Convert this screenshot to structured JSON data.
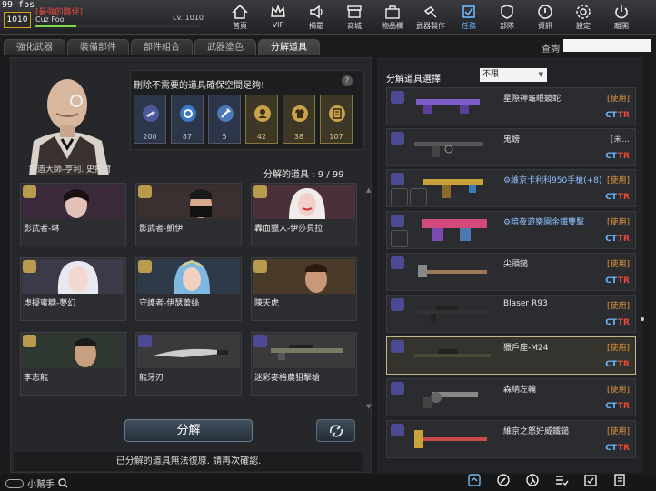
{
  "fps": "99 fps",
  "player": {
    "level_badge": "1010",
    "clan": "[最強的夥伴]",
    "name": "Cuz Foo",
    "level": "Lv. 1010"
  },
  "nav": [
    {
      "label": "首頁",
      "icon": "home-icon"
    },
    {
      "label": "VIP",
      "icon": "crown-icon"
    },
    {
      "label": "揭罷",
      "icon": "megaphone-icon"
    },
    {
      "label": "商城",
      "icon": "shop-icon"
    },
    {
      "label": "物品欄",
      "icon": "bag-icon"
    },
    {
      "label": "武器製作",
      "icon": "hammer-icon"
    },
    {
      "label": "任務",
      "icon": "mission-icon",
      "active": true
    },
    {
      "label": "部隊",
      "icon": "shield-icon"
    },
    {
      "label": "資訊",
      "icon": "info-icon"
    },
    {
      "label": "設定",
      "icon": "gear-icon"
    },
    {
      "label": "離開",
      "icon": "power-icon"
    }
  ],
  "tabs": [
    "強化武器",
    "裝備部件",
    "部件組合",
    "武器塗色",
    "分解道具"
  ],
  "active_tab": 4,
  "search": {
    "label": "查詢",
    "value": ""
  },
  "left": {
    "npc_name": "鍛造大師-亨利. 史托爾",
    "notice": "刪除不需要的道具確保空間足夠!",
    "help": "?",
    "stats": [
      {
        "icon": "rifle-icon",
        "value": "200"
      },
      {
        "icon": "gear-part-icon",
        "value": "87"
      },
      {
        "icon": "wrench-icon",
        "value": "5"
      },
      {
        "icon": "character-icon",
        "value": "42"
      },
      {
        "icon": "shirt-icon",
        "value": "38"
      },
      {
        "icon": "scroll-icon",
        "value": "107"
      }
    ],
    "count_label": "分解的道具 : 9 / 99",
    "cards": [
      {
        "name": "影武者-琳",
        "type": "char",
        "tone": "#3a2a3a"
      },
      {
        "name": "影武者-凱伊",
        "type": "char",
        "tone": "#3a3030"
      },
      {
        "name": "轟血獵人-伊莎貝拉",
        "type": "char",
        "tone": "#4a3038"
      },
      {
        "name": "虛擬蜜糖-夢幻",
        "type": "char",
        "tone": "#3a3a48"
      },
      {
        "name": "守護者-伊瑟蕾絲",
        "type": "char",
        "tone": "#2e3a48"
      },
      {
        "name": "陳天虎",
        "type": "char",
        "tone": "#4a3a2a"
      },
      {
        "name": "李志龍",
        "type": "char",
        "tone": "#2e3830"
      },
      {
        "name": "龍牙刃",
        "type": "wpn",
        "tone": "#3a3a3c"
      },
      {
        "name": "迷彩麥格農狙擊槍",
        "type": "wpn",
        "tone": "#3a3a3c"
      }
    ],
    "decompose_button": "分解",
    "warning": "已分解的道具無法復原. 請再次確認."
  },
  "right": {
    "title": "分解道具選擇",
    "filter": "不限",
    "items": [
      {
        "name": "星際神龜眼鏡蛇",
        "use": "[使用]",
        "color": "#7b5cc9",
        "selected": false
      },
      {
        "name": "鬼螃",
        "use": "[未...",
        "color": "#666",
        "selected": false
      },
      {
        "name": "維京卡利科950手槍(+8)",
        "use": "[使用]",
        "color": "#c9a13c",
        "selected": false,
        "slots": true,
        "prefix": "⚙"
      },
      {
        "name": "暗夜遊樂園金鐵雙擊",
        "use": "[使用]",
        "color": "#d24a7a",
        "selected": false,
        "slots": true,
        "prefix": "⚙"
      },
      {
        "name": "尖頭鎚",
        "use": "[使用]",
        "color": "#9a7a5a",
        "selected": false
      },
      {
        "name": "Blaser R93",
        "use": "[使用]",
        "color": "#333",
        "selected": false
      },
      {
        "name": "獵戶座-M24",
        "use": "[使用]",
        "color": "#4a4a3a",
        "selected": true
      },
      {
        "name": "森納左輪",
        "use": "[使用]",
        "color": "#888",
        "selected": false
      },
      {
        "name": "維京之怒好威鐵鎚",
        "use": "[使用]",
        "color": "#c94a4a",
        "selected": false
      }
    ],
    "ct": "CT",
    "tr": "TR"
  },
  "bottom": {
    "helper": "小幫手"
  }
}
